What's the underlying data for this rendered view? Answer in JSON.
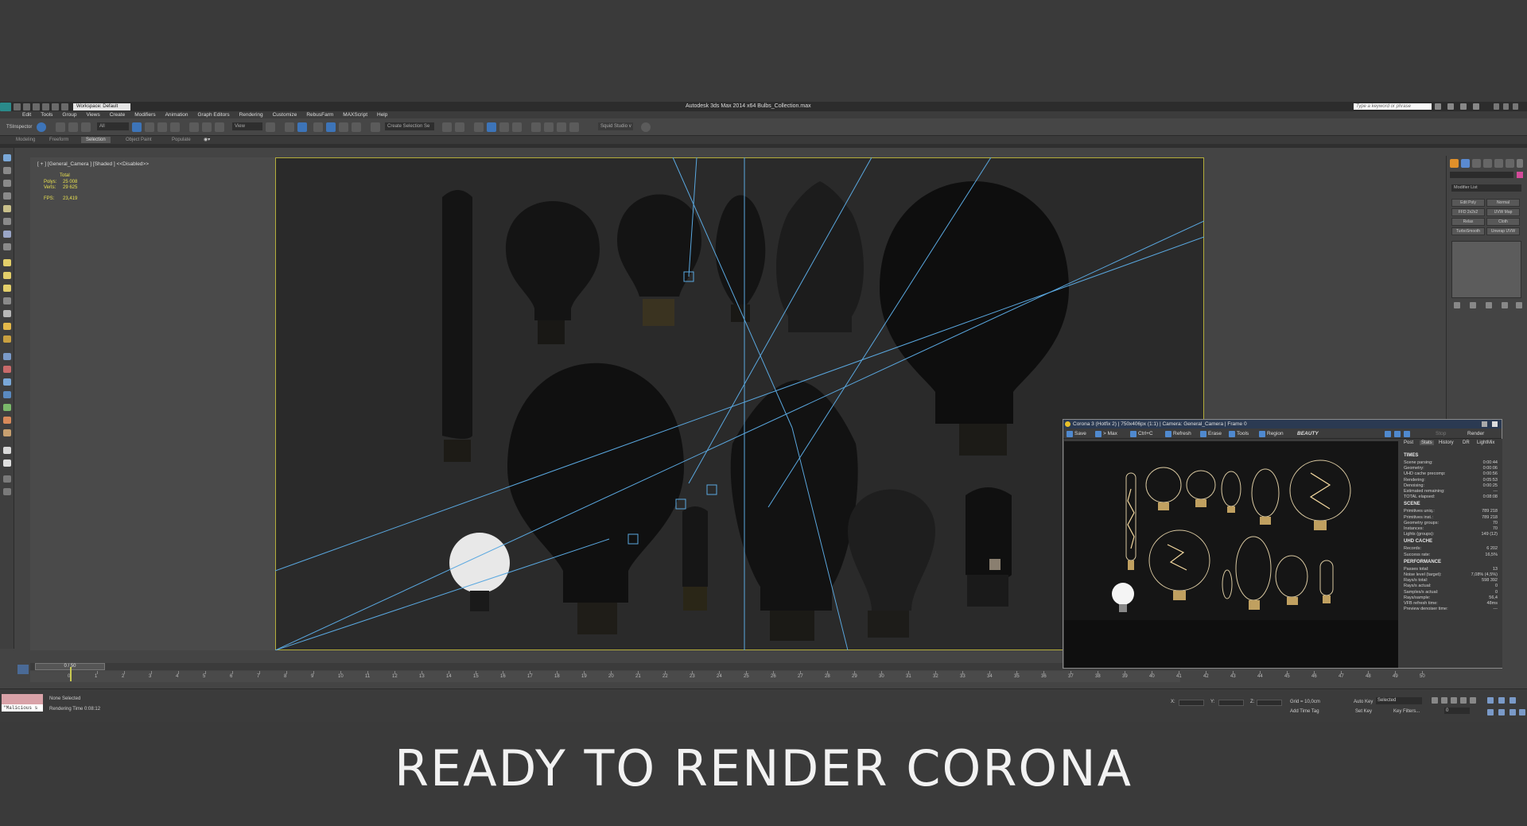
{
  "app": {
    "title": "Autodesk 3ds Max  2014 x64     Bulbs_Collection.max",
    "workspace": "Workspace: Default",
    "search_placeholder": "Type a keyword or phrase"
  },
  "menu": [
    "Edit",
    "Tools",
    "Group",
    "Views",
    "Create",
    "Modifiers",
    "Animation",
    "Graph Editors",
    "Rendering",
    "Customize",
    "RebusFarm",
    "MAXScript",
    "Help"
  ],
  "toolbar": {
    "ts_inspector": "TSInspector",
    "filter": "All",
    "ref_coord": "View",
    "selection_set": "Create Selection Se",
    "squid": "Squid Studio v"
  },
  "ribbon_tabs": [
    "Modeling",
    "Freeform",
    "Selection",
    "Object Paint",
    "Populate"
  ],
  "viewport": {
    "label": "[ + ] [General_Camera ] [Shaded ] <<Disabled>>",
    "stats": {
      "total_label": "Total",
      "polys_label": "Polys:",
      "polys": "25 008",
      "verts_label": "Verts:",
      "verts": "29 625",
      "fps_label": "FPS:",
      "fps": "23,419"
    }
  },
  "command_panel": {
    "modifier_list": "Modifier List",
    "buttons": [
      "Edit Poly",
      "Normal",
      "FFD 2x2x2",
      "UVW Map",
      "Relax",
      "Cloth",
      "TurboSmooth",
      "Unwrap UVW"
    ]
  },
  "timeline": {
    "frame_display": "0 / 50",
    "ticks": [
      "0",
      "1",
      "2",
      "3",
      "4",
      "5",
      "6",
      "7",
      "8",
      "9",
      "10",
      "11",
      "12",
      "13",
      "14",
      "15",
      "16",
      "17",
      "18",
      "19",
      "20",
      "21",
      "22",
      "23",
      "24",
      "25",
      "26",
      "27",
      "28",
      "29",
      "30",
      "31",
      "32",
      "33",
      "34",
      "35",
      "36",
      "37",
      "38",
      "39",
      "40",
      "41",
      "42",
      "43",
      "44",
      "45",
      "46",
      "47",
      "48",
      "49",
      "50"
    ]
  },
  "status": {
    "listener": "\"Malicious s",
    "selection": "None Selected",
    "render_time": "Rendering Time  0:08:12",
    "x_label": "X:",
    "y_label": "Y:",
    "z_label": "Z:",
    "grid": "Grid = 10,0cm",
    "auto_key": "Auto Key",
    "auto_key_mode": "Selected",
    "set_key": "Set Key",
    "key_filters": "Key Filters...",
    "add_time_tag": "Add Time Tag",
    "frame": "0"
  },
  "vfb": {
    "title": "Corona 3 (Hotfix 2) | 750x406px (1:1) | Camera: General_Camera | Frame 0",
    "buttons": [
      "Save",
      "> Max",
      "Ctrl+C",
      "Refresh",
      "Erase",
      "Tools",
      "Region"
    ],
    "render_element": "BEAUTY",
    "stop": "Stop",
    "render": "Render",
    "tabs": [
      "Post",
      "Stats",
      "History",
      "DR",
      "LightMix"
    ],
    "sections": [
      {
        "title": "TIMES",
        "rows": [
          [
            "Scene parsing:",
            "0:00:44"
          ],
          [
            "Geometry:",
            "0:00:06"
          ],
          [
            "UHD cache precomp:",
            "0:00:56"
          ],
          [
            "Rendering:",
            "0:05:53"
          ],
          [
            "Denoising:",
            "0:00:25"
          ],
          [
            "Estimated remaining:",
            "---"
          ],
          [
            "TOTAL elapsed:",
            "0:08:08"
          ]
        ]
      },
      {
        "title": "SCENE",
        "rows": [
          [
            "Primitives uniq.:",
            "789 218"
          ],
          [
            "Primitives inst.:",
            "789 218"
          ],
          [
            "Geometry groups:",
            "70"
          ],
          [
            "Instances:",
            "70"
          ],
          [
            "Lights (groups):",
            "149 (12)"
          ]
        ]
      },
      {
        "title": "UHD CACHE",
        "rows": [
          [
            "Records:",
            "6 202"
          ],
          [
            "Success rate:",
            "16,5%"
          ]
        ]
      },
      {
        "title": "PERFORMANCE",
        "rows": [
          [
            "Passes total:",
            "13"
          ],
          [
            "Noise level (target):",
            "7,08% (4,5%)"
          ],
          [
            "Rays/s total:",
            "598 392"
          ],
          [
            "Rays/s actual:",
            "0"
          ],
          [
            "Samples/s actual:",
            "0"
          ],
          [
            "Rays/sample:",
            "56,4"
          ],
          [
            "VFB refresh time:",
            "48ms"
          ],
          [
            "Preview denoiser time:",
            "---"
          ]
        ]
      }
    ]
  },
  "caption": "READY TO RENDER CORONA",
  "colors": {
    "safe_frame": "#b4ad3a",
    "stats_text": "#e8e050",
    "camera_lines": "#5aa8e0",
    "listener_bg": "#d9a2a8"
  }
}
